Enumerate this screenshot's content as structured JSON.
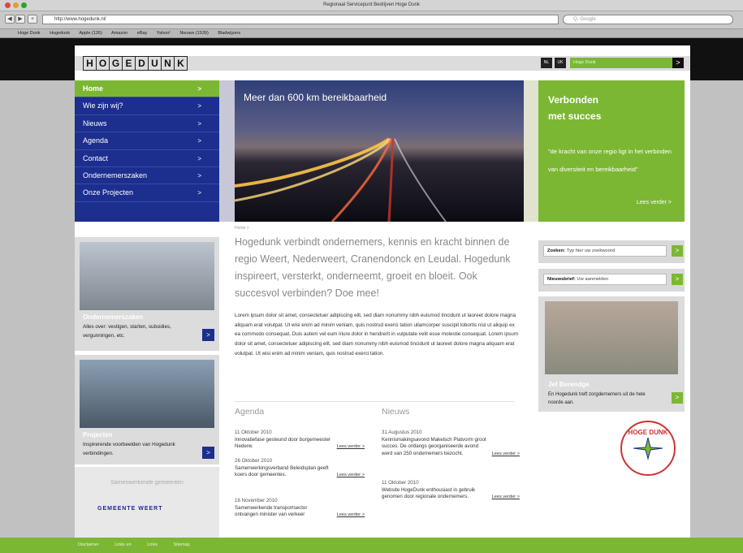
{
  "browser": {
    "window_title": "Regionaal Servicepunt Bedrijven Hoge Dunk",
    "url": "http://www.hogedunk.nl/",
    "search_placeholder": "Q- Google",
    "bookmarks": [
      "Hoge Dunk",
      "Hogedunk",
      "Apple (126)",
      "Amazon",
      "eBay",
      "Yahoo!",
      "Nieuws (1539)",
      "Bladwijzers"
    ]
  },
  "header": {
    "logo_letters": [
      "H",
      "O",
      "G",
      "E",
      "D",
      "U",
      "N",
      "K"
    ],
    "lang_nl": "NL",
    "lang_uk": "UK",
    "search_placeholder": "Hoge Dunk",
    "search_go": ">"
  },
  "nav": {
    "items": [
      {
        "label": "Home",
        "active": true
      },
      {
        "label": "Wie zijn wij?"
      },
      {
        "label": "Nieuws"
      },
      {
        "label": "Agenda"
      },
      {
        "label": "Contact"
      },
      {
        "label": "Ondernemerszaken"
      },
      {
        "label": "Onze Projecten"
      }
    ],
    "arrow": ">"
  },
  "hero": {
    "title": "Meer dan 600 km bereikbaarheid"
  },
  "green_box": {
    "title_line1": "Verbonden",
    "title_line2": "met succes",
    "quote": "\"de kracht van onze regio ligt in het verbinden van diversiteit en bereikbaarheid\"",
    "more": "Lees verder >"
  },
  "main": {
    "breadcrumb": "Home >",
    "intro": "Hogedunk verbindt ondernemers, kennis en kracht binnen de regio Weert, Nederweert, Cranendonck en Leudal. Hogedunk inspireert, versterkt, onderneemt, groeit en bloeit. Ook succesvol verbinden? Doe mee!",
    "body": "Lorem ipsum dolor sit amet, consectetuer adipiscing elit, sed diam nonummy nibh euismod tincidunt ut laoreet dolore magna aliquam erat volutpat. Ut wisi enim ad minim veniam, quis nostrud exerci tation ullamcorper suscipit lobortis nisl ut aliquip ex ea commodo consequat. Duis autem vel eum iriure dolor in hendrerit in vulputate velit esse molestie consequat. Lorem ipsum dolor sit amet, consectetuer adipiscing elit, sed diam nonummy nibh euismod tincidunt ut laoreet dolore magna aliquam erat volutpat. Ut wisi enim ad minim veniam, quis nostrud exerci tation."
  },
  "agenda": {
    "heading": "Agenda",
    "items": [
      {
        "date": "11 Oktober 2010",
        "text": "Innovatiefase gesteund door burgemeester Nederw.",
        "more": "Lees verder >"
      },
      {
        "date": "26 Oktober 2010",
        "text": "Samenwerkingsverband Beleidsplan geeft koers door gemeentes.",
        "more": "Lees verder >"
      },
      {
        "date": "16 November 2010",
        "text": "Samenwerkende transportsector ontvangen minister van verkeer",
        "more": "Lees verder >"
      }
    ]
  },
  "nieuws": {
    "heading": "Nieuws",
    "items": [
      {
        "date": "31 Augustus 2010",
        "text": "Kennismakingsavond Makelsch Platvorm groot succes. De ontlangs georganiseerde avond werd van 250 ondernemers bezocht.",
        "more": "Lees verder >"
      },
      {
        "date": "11 Oktober 2010",
        "text": "Website HogeDunk enthousiast in gebruik genomen door regionale ondernemers.",
        "more": "Lees verder >"
      }
    ]
  },
  "left_cards": [
    {
      "label": "Ondernemerszaken",
      "text": "Alles over: vestigen, starten, subsidies, vergunningen, etc.",
      "go": ">"
    },
    {
      "label": "Projecten",
      "text": "Inspirerende voorbeelden van Hogedunk verbindingen.",
      "go": ">"
    }
  ],
  "gemeente": {
    "title": "Samenwerkende gemeenten",
    "logo_text": "GEMEENTE WEERT"
  },
  "right": {
    "search_label": "Zoeken:",
    "search_placeholder": "Typ hier uw zoekwoord",
    "news_label": "Nieuwsbrief:",
    "news_placeholder": "Uw aanmelden",
    "go": ">",
    "person_name": "Jef Berendge",
    "person_text": "En Hogedunk treft zorgdernemers uit de hele noorde aan.",
    "stamp": "HOGE DUNK"
  },
  "footer": {
    "links": [
      "Disclaimer",
      "Links en",
      "Links",
      "Sitemap"
    ]
  },
  "colors": {
    "green": "#7cb734",
    "blue": "#1c2e8e",
    "dark": "#111111"
  }
}
